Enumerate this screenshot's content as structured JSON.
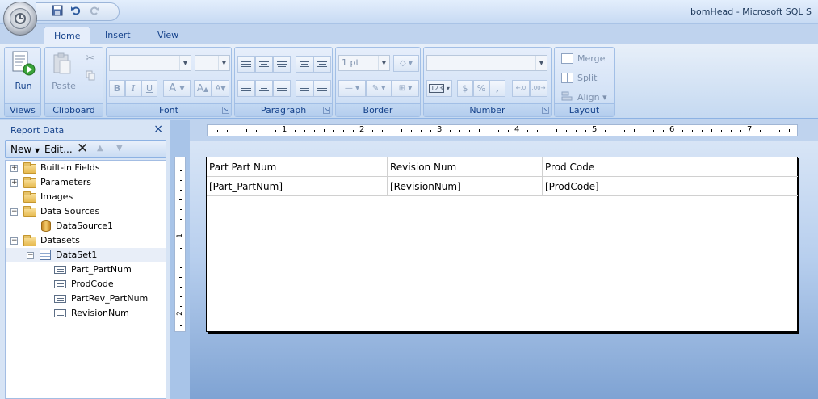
{
  "window": {
    "title": "bomHead - Microsoft SQL S"
  },
  "tabs": [
    {
      "label": "Home",
      "active": true
    },
    {
      "label": "Insert",
      "active": false
    },
    {
      "label": "View",
      "active": false
    }
  ],
  "ribbon": {
    "views": {
      "label": "Views",
      "run_label": "Run"
    },
    "clipboard": {
      "label": "Clipboard",
      "paste_label": "Paste"
    },
    "font": {
      "label": "Font"
    },
    "paragraph": {
      "label": "Paragraph"
    },
    "border": {
      "label": "Border",
      "width_value": "1 pt"
    },
    "number": {
      "label": "Number",
      "placeholder_icon": "123"
    },
    "layout": {
      "label": "Layout",
      "merge_label": "Merge",
      "split_label": "Split",
      "align_label": "Align"
    }
  },
  "report_data": {
    "title": "Report Data",
    "toolbar": {
      "new_label": "New",
      "edit_label": "Edit..."
    },
    "tree": [
      {
        "label": "Built-in Fields",
        "type": "folder",
        "expander": "+"
      },
      {
        "label": "Parameters",
        "type": "folder",
        "expander": "+"
      },
      {
        "label": "Images",
        "type": "folder",
        "expander": ""
      },
      {
        "label": "Data Sources",
        "type": "folder",
        "expander": "−"
      },
      {
        "label": "DataSource1",
        "type": "datasource",
        "expander": ""
      },
      {
        "label": "Datasets",
        "type": "folder",
        "expander": "−"
      },
      {
        "label": "DataSet1",
        "type": "dataset",
        "expander": "−"
      },
      {
        "label": "Part_PartNum",
        "type": "field",
        "expander": ""
      },
      {
        "label": "ProdCode",
        "type": "field",
        "expander": ""
      },
      {
        "label": "PartRev_PartNum",
        "type": "field",
        "expander": ""
      },
      {
        "label": "RevisionNum",
        "type": "field",
        "expander": ""
      }
    ]
  },
  "ruler": {
    "h_numbers": [
      "1",
      "2",
      "3",
      "4",
      "5",
      "6",
      "7"
    ],
    "v_numbers": [
      "1",
      "2"
    ]
  },
  "report": {
    "headers": [
      "Part Part Num",
      "Revision Num",
      "Prod Code"
    ],
    "row": [
      "[Part_PartNum]",
      "[RevisionNum]",
      "[ProdCode]"
    ]
  },
  "icons": {
    "orb": "office-orb-icon",
    "save": "save-icon",
    "undo": "undo-icon",
    "redo": "redo-icon"
  }
}
